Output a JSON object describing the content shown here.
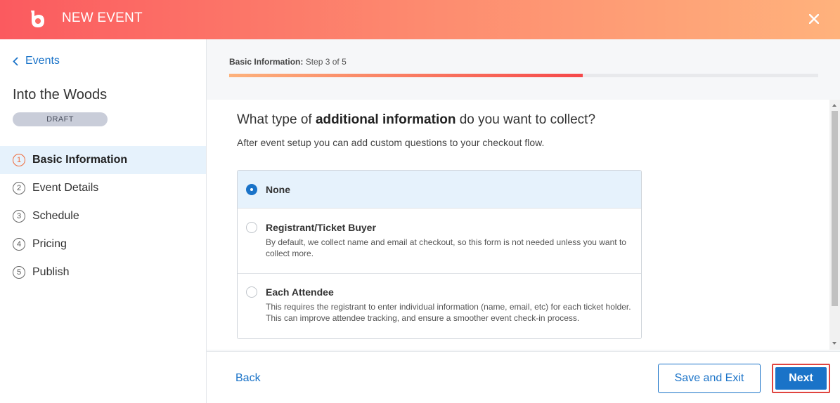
{
  "header": {
    "title": "NEW EVENT",
    "logo_icon": "brand-logo-icon",
    "close_icon": "close-icon",
    "gradient_colors": [
      "#fb5a5f",
      "#ffb27c"
    ]
  },
  "sidebar": {
    "back_label": "Events",
    "event_name": "Into the Woods",
    "status_badge": "DRAFT",
    "steps": [
      {
        "number": "1",
        "label": "Basic Information",
        "active": true
      },
      {
        "number": "2",
        "label": "Event Details",
        "active": false
      },
      {
        "number": "3",
        "label": "Schedule",
        "active": false
      },
      {
        "number": "4",
        "label": "Pricing",
        "active": false
      },
      {
        "number": "5",
        "label": "Publish",
        "active": false
      }
    ]
  },
  "progress": {
    "section_label": "Basic Information:",
    "step_text": "Step 3 of 5",
    "fraction": 0.6
  },
  "question": {
    "prefix": "What type of ",
    "emphasis": "additional information",
    "suffix": " do you want to collect?",
    "subtext": "After event setup you can add custom questions to your checkout flow."
  },
  "options": [
    {
      "title": "None",
      "description": "",
      "selected": true
    },
    {
      "title": "Registrant/Ticket Buyer",
      "description": "By default, we collect name and email at checkout, so this form is not needed unless you want to collect more.",
      "selected": false
    },
    {
      "title": "Each Attendee",
      "description": "This requires the registrant to enter individual information (name, email, etc) for each ticket holder. This can improve attendee tracking, and ensure a smoother event check-in process.",
      "selected": false
    }
  ],
  "footer": {
    "back_label": "Back",
    "save_label": "Save and Exit",
    "next_label": "Next"
  },
  "colors": {
    "accent": "#1a73c8",
    "active_step": "#ef6a3a",
    "highlight_outline": "#e0443f"
  }
}
